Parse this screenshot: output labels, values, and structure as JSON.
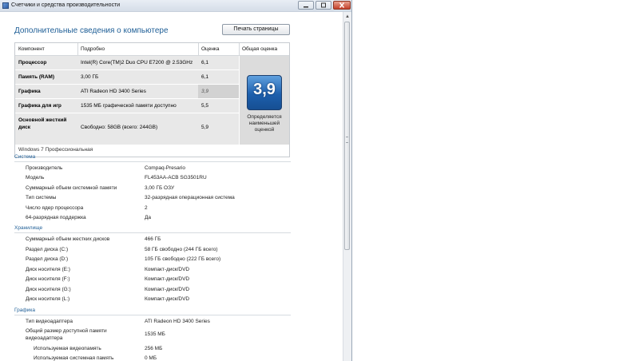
{
  "window": {
    "title": "Счетчики и средства производительности"
  },
  "header": {
    "title": "Дополнительные сведения о компьютере",
    "print_button": "Печать страницы"
  },
  "score_table": {
    "headers": {
      "component": "Компонент",
      "details": "Подробно",
      "score": "Оценка",
      "overall": "Общая оценка"
    },
    "rows": [
      {
        "component": "Процессор",
        "details": "Intel(R) Core(TM)2 Duo CPU E7200 @ 2.53GHz",
        "score": "6,1"
      },
      {
        "component": "Память (RAM)",
        "details": "3,00 ГБ",
        "score": "6,1"
      },
      {
        "component": "Графика",
        "details": "ATI Radeon HD 3400 Series",
        "score": "3,9"
      },
      {
        "component": "Графика для игр",
        "details": "1535 МБ графической памяти доступно",
        "score": "5,5"
      },
      {
        "component_line1": "Основной жесткий",
        "component_line2": "диск",
        "details": "Свободно: 58GB (всего: 244GB)",
        "score": "5,9"
      }
    ],
    "overall_score": "3,9",
    "overall_note": "Определяется наименьшей оценкой",
    "edition": "Windows 7 Профессиональная"
  },
  "system": {
    "heading": "Система",
    "items": [
      {
        "label": "Производитель",
        "value": "Compaq-Presario"
      },
      {
        "label": "Модель",
        "value": "FL453AA-ACB SG3501RU"
      },
      {
        "label": "Суммарный объем системной памяти",
        "value": "3,00 ГБ ОЗУ"
      },
      {
        "label": "Тип системы",
        "value": "32-разрядная операционная система"
      },
      {
        "label": "Число ядер процессора",
        "value": "2"
      },
      {
        "label": "64-разрядная поддержка",
        "value": "Да"
      }
    ]
  },
  "storage": {
    "heading": "Хранилище",
    "items": [
      {
        "label": "Суммарный объем жестких дисков",
        "value": "466 ГБ"
      },
      {
        "label": "Раздел диска (C:)",
        "value": "58 ГБ свободно (244 ГБ всего)"
      },
      {
        "label": "Раздел диска (D:)",
        "value": "105 ГБ свободно (222 ГБ всего)"
      },
      {
        "label": "Диск носителя (E:)",
        "value": "Компакт-диск/DVD"
      },
      {
        "label": "Диск носителя (F:)",
        "value": "Компакт-диск/DVD"
      },
      {
        "label": "Диск носителя (G:)",
        "value": "Компакт-диск/DVD"
      },
      {
        "label": "Диск носителя (L:)",
        "value": "Компакт-диск/DVD"
      }
    ]
  },
  "graphics": {
    "heading": "Графика",
    "items": [
      {
        "label": "Тип видеоадаптера",
        "value": "ATI Radeon HD 3400 Series"
      },
      {
        "label_line1": "Общий размер доступной памяти",
        "label_line2": "видеоадаптера",
        "value": "1535 МБ"
      },
      {
        "label": "Используемая видеопамять",
        "value": "256 МБ"
      },
      {
        "label": "Используемая системная память",
        "value": "0 МБ"
      }
    ]
  }
}
